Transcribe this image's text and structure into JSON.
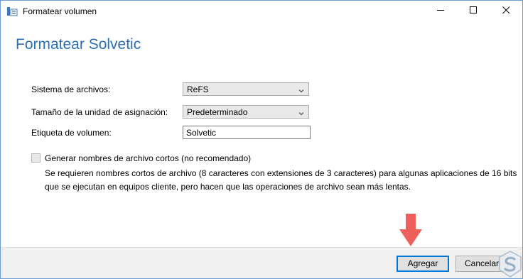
{
  "window": {
    "title": "Formatear volumen",
    "heading": "Formatear Solvetic"
  },
  "form": {
    "filesystem_label": "Sistema de archivos:",
    "filesystem_value": "ReFS",
    "allocation_label": "Tamaño de la unidad de asignación:",
    "allocation_value": "Predeterminado",
    "volume_label_label": "Etiqueta de volumen:",
    "volume_label_value": "Solvetic"
  },
  "short_names": {
    "checkbox_label": "Generar nombres de archivo cortos (no recomendado)",
    "checked": false,
    "description_line1": "Se requieren nombres cortos de archivo (8 caracteres con extensiones de 3 caracteres) para algunas aplicaciones de 16 bits",
    "description_line2": "que se ejecutan en equipos cliente, pero hacen que las operaciones de archivo sean más lentas."
  },
  "buttons": {
    "add": "Agregar",
    "cancel": "Cancelar"
  },
  "colors": {
    "accent": "#0078d7",
    "heading": "#2b6fb6",
    "arrow": "#f0605a"
  },
  "icons": {
    "app": "volume-icon",
    "minimize": "minimize-icon",
    "maximize": "maximize-icon",
    "close": "close-icon",
    "dropdown": "chevron-down-icon",
    "annotation": "red-arrow-down-icon",
    "watermark": "solvetic-logo-icon"
  }
}
